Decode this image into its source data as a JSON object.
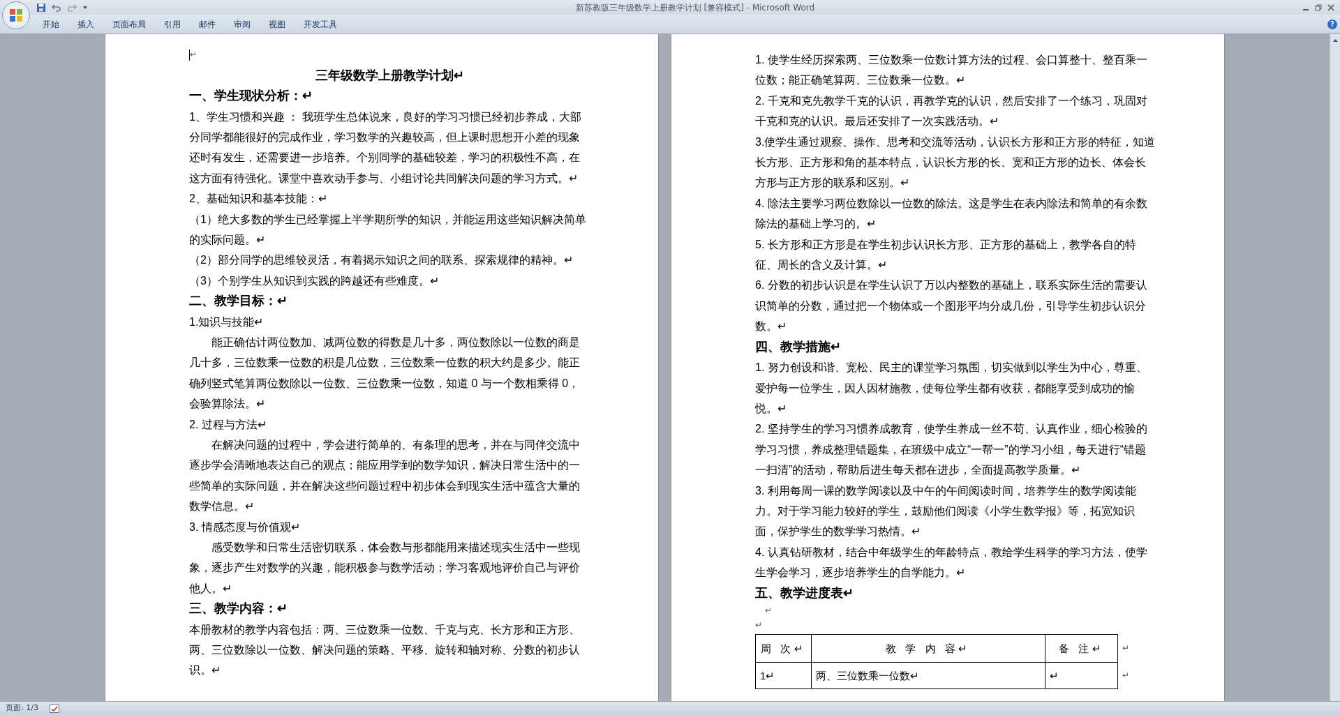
{
  "window": {
    "title": "新苏教版三年级数学上册教学计划 [兼容模式] - Microsoft Word"
  },
  "ribbon_tabs": [
    {
      "label": "开始"
    },
    {
      "label": "插入"
    },
    {
      "label": "页面布局"
    },
    {
      "label": "引用"
    },
    {
      "label": "邮件"
    },
    {
      "label": "审阅"
    },
    {
      "label": "视图"
    },
    {
      "label": "开发工具"
    }
  ],
  "help": "?",
  "pages": [
    {
      "blocks": [
        {
          "kind": "empty",
          "text": "↵",
          "cursor": true
        },
        {
          "kind": "title",
          "text": "三年级数学上册教学计划↵"
        },
        {
          "kind": "heading",
          "text": "一、学生现状分析：↵"
        },
        {
          "kind": "para",
          "text": "1、学生习惯和兴趣 ： 我班学生总体说来，良好的学习习惯已经初步养成，大部分同学都能很好的完成作业，学习数学的兴趣较高，但上课时思想开小差的现象还时有发生，还需要进一步培养。个别同学的基础较差，学习的积极性不高，在这方面有待强化。课堂中喜欢动手参与、小组讨论共同解决问题的学习方式。↵"
        },
        {
          "kind": "para",
          "text": "2、基础知识和基本技能：↵"
        },
        {
          "kind": "para",
          "text": "（1）绝大多数的学生已经掌握上半学期所学的知识，并能运用这些知识解决简单的实际问题。↵"
        },
        {
          "kind": "para",
          "text": "（2）部分同学的思维较灵活，有着揭示知识之间的联系、探索规律的精神。↵"
        },
        {
          "kind": "para",
          "text": "（3）个别学生从知识到实践的跨越还有些难度。↵"
        },
        {
          "kind": "heading",
          "text": "二、教学目标：↵"
        },
        {
          "kind": "para",
          "text": "1.知识与技能↵"
        },
        {
          "kind": "indented",
          "text": "能正确估计两位数加、减两位数的得数是几十多，两位数除以一位数的商是几十多，三位数乘一位数的积是几位数，三位数乘一位数的积大约是多少。能正确列竖式笔算两位数除以一位数、三位数乘一位数，知道 0 与一个数相乘得 0，会验算除法。↵"
        },
        {
          "kind": "para",
          "text": "2. 过程与方法↵"
        },
        {
          "kind": "indented",
          "text": "在解决问题的过程中，学会进行简单的、有条理的思考，并在与同伴交流中逐步学会清晰地表达自己的观点；能应用学到的数学知识，解决日常生活中的一些简单的实际问题，并在解决这些问题过程中初步体会到现实生活中蕴含大量的数学信息。↵"
        },
        {
          "kind": "para",
          "text": "3. 情感态度与价值观↵"
        },
        {
          "kind": "indented",
          "text": "感受数学和日常生活密切联系，体会数与形都能用来描述现实生活中一些现象，逐步产生对数学的兴趣，能积极参与数学活动；学习客观地评价自己与评价他人。↵"
        },
        {
          "kind": "heading",
          "text": "三、教学内容：↵"
        },
        {
          "kind": "para",
          "text": "本册教材的教学内容包括：两、三位数乘一位数、千克与克、长方形和正方形、两、三位数除以一位数、解决问题的策略、平移、旋转和轴对称、分数的初步认识。↵"
        }
      ]
    },
    {
      "blocks": [
        {
          "kind": "para",
          "text": "1. 使学生经历探索两、三位数乘一位数计算方法的过程、会口算整十、整百乘一位数；能正确笔算两、三位数乘一位数。↵"
        },
        {
          "kind": "para",
          "text": "2. 千克和克先教学千克的认识，再教学克的认识，然后安排了一个练习，巩固对千克和克的认识。最后还安排了一次实践活动。↵"
        },
        {
          "kind": "para",
          "text": "3.使学生通过观察、操作、思考和交流等活动，认识长方形和正方形的特征，知道长方形、正方形和角的基本特点，认识长方形的长、宽和正方形的边长、体会长方形与正方形的联系和区别。↵"
        },
        {
          "kind": "para",
          "text": "4. 除法主要学习两位数除以一位数的除法。这是学生在表内除法和简单的有余数除法的基础上学习的。↵"
        },
        {
          "kind": "para",
          "text": "5. 长方形和正方形是在学生初步认识长方形、正方形的基础上，教学各自的特征、周长的含义及计算。↵"
        },
        {
          "kind": "para",
          "text": "6. 分数的初步认识是在学生认识了万以内整数的基础上，联系实际生活的需要认识简单的分数，通过把一个物体或一个图形平均分成几份，引导学生初步认识分数。↵"
        },
        {
          "kind": "heading",
          "text": "四、教学措施↵"
        },
        {
          "kind": "para",
          "text": "1. 努力创设和谐、宽松、民主的课堂学习氛围，切实做到以学生为中心，尊重、爱护每一位学生，因人因材施教，使每位学生都有收获，都能享受到成功的愉悦。↵"
        },
        {
          "kind": "para",
          "text": "2. 坚持学生的学习习惯养成教育，使学生养成一丝不苟、认真作业，细心检验的学习习惯，养成整理错题集，在班级中成立“一帮一”的学习小组，每天进行“错题一扫清”的活动，帮助后进生每天都在进步，全面提高教学质量。↵"
        },
        {
          "kind": "para",
          "text": "3. 利用每周一课的数学阅读以及中午的午间阅读时间，培养学生的数学阅读能力。对于学习能力较好的学生，鼓励他们阅读《小学生数学报》等，拓宽知识面，保护学生的数学学习热情。↵"
        },
        {
          "kind": "para",
          "text": "4. 认真钻研教材，结合中年级学生的年龄特点，教给学生科学的学习方法，使学生学会学习，逐步培养学生的自学能力。↵"
        },
        {
          "kind": "heading",
          "text": "五、教学进度表↵"
        },
        {
          "kind": "empty",
          "text": "↵",
          "cursor": false
        },
        {
          "kind": "empty",
          "text": "↵",
          "cursor": false
        },
        {
          "kind": "table",
          "columns": [
            "周 次↵",
            "教 学 内 容↵",
            "备 注↵"
          ],
          "header_mark": "↵",
          "rows": [
            {
              "cells": [
                "1↵",
                "两、三位数乘一位数↵",
                "↵"
              ],
              "mark": "↵"
            }
          ]
        }
      ]
    }
  ],
  "status_bar": {
    "page": "页面: 1/3"
  }
}
